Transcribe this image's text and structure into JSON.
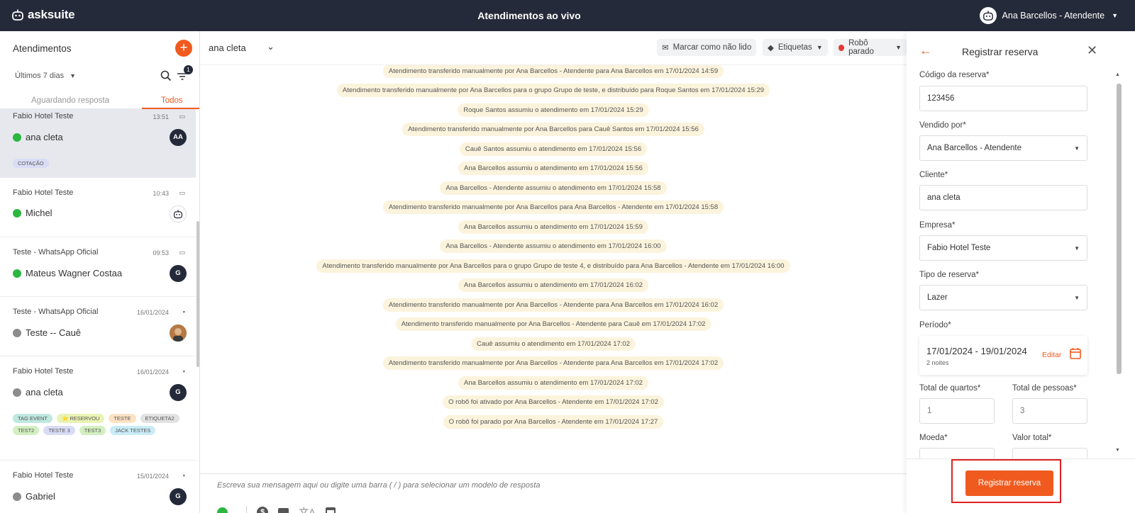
{
  "topbar": {
    "brand": "asksuite",
    "title": "Atendimentos ao vivo",
    "user": "Ana Barcellos - Atendente"
  },
  "left": {
    "title": "Atendimentos",
    "period": "Últimos 7 dias",
    "filter_count": "1",
    "tabs": [
      "Aguardando resposta",
      "Todos"
    ],
    "conversations": [
      {
        "source": "Fabio Hotel Teste",
        "time": "13:51",
        "name": "ana cleta",
        "avatar": "AA",
        "tags": [
          "COTAÇÃO"
        ]
      },
      {
        "source": "Fabio Hotel Teste",
        "time": "10:43",
        "name": "Michel",
        "avatar": "",
        "tags": []
      },
      {
        "source": "Teste - WhatsApp Oficial",
        "time": "09:53",
        "name": "Mateus Wagner Costaa",
        "avatar": "G",
        "tags": []
      },
      {
        "source": "Teste - WhatsApp Oficial",
        "time": "16/01/2024",
        "name": "Teste -- Cauê",
        "avatar": "",
        "tags": []
      },
      {
        "source": "Fabio Hotel Teste",
        "time": "16/01/2024",
        "name": "ana cleta",
        "avatar": "G",
        "tags": [
          "TAG EVENT",
          "⭐ RESERVOU",
          "TESTE",
          "ETIQUETA2",
          "TEST2",
          "TESTE 3",
          "TEST3",
          "JACK TESTES"
        ]
      },
      {
        "source": "Fabio Hotel Teste",
        "time": "15/01/2024",
        "name": "Gabriel",
        "avatar": "G",
        "tags": []
      }
    ]
  },
  "middle": {
    "contact_name": "ana cleta",
    "mark_unread": "Marcar como não lido",
    "labels": "Etiquetas",
    "robot_status": "Robô parado",
    "events": [
      "Atendimento transferido manualmente por Ana Barcellos - Atendente para Ana Barcellos em 17/01/2024 14:59",
      "Atendimento transferido manualmente por Ana Barcellos para o grupo Grupo de teste, e distribuído para Roque Santos em 17/01/2024 15:29",
      "Roque Santos assumiu o atendimento em 17/01/2024 15:29",
      "Atendimento transferido manualmente por Ana Barcellos para Cauê Santos em 17/01/2024 15:56",
      "Cauê Santos assumiu o atendimento em 17/01/2024 15:56",
      "Ana Barcellos assumiu o atendimento em 17/01/2024 15:56",
      "Ana Barcellos - Atendente assumiu o atendimento em 17/01/2024 15:58",
      "Atendimento transferido manualmente por Ana Barcellos para Ana Barcellos - Atendente em 17/01/2024 15:58",
      "Ana Barcellos assumiu o atendimento em 17/01/2024 15:59",
      "Ana Barcellos - Atendente assumiu o atendimento em 17/01/2024 16:00",
      "Atendimento transferido manualmente por Ana Barcellos para o grupo Grupo de teste 4, e distribuído para Ana Barcellos - Atendente em 17/01/2024 16:00",
      "Ana Barcellos assumiu o atendimento em 17/01/2024 16:02",
      "Atendimento transferido manualmente por Ana Barcellos - Atendente para Ana Barcellos em 17/01/2024 16:02",
      "Atendimento transferido manualmente por Ana Barcellos - Atendente para Cauê em 17/01/2024 17:02",
      "Cauê assumiu o atendimento em 17/01/2024 17:02",
      "Atendimento transferido manualmente por Ana Barcellos - Atendente para Ana Barcellos em 17/01/2024 17:02",
      "Ana Barcellos assumiu o atendimento em 17/01/2024 17:02",
      "O robô foi ativado por Ana Barcellos - Atendente em 17/01/2024 17:02",
      "O robô foi parado por Ana Barcellos - Atendente em 17/01/2024 17:27"
    ],
    "composer_placeholder": "Escreva sua mensagem aqui ou digite uma barra ( / ) para selecionar um modelo de resposta"
  },
  "right": {
    "title": "Registrar reserva",
    "fields": {
      "codigo_label": "Código da reserva*",
      "codigo_value": "123456",
      "vendido_label": "Vendido por*",
      "vendido_value": "Ana Barcellos - Atendente",
      "cliente_label": "Cliente*",
      "cliente_value": "ana cleta",
      "empresa_label": "Empresa*",
      "empresa_value": "Fabio Hotel Teste",
      "tipo_label": "Tipo de reserva*",
      "tipo_value": "Lazer",
      "periodo_label": "Período*",
      "periodo_dates": "17/01/2024 - 19/01/2024",
      "periodo_nights": "2 noites",
      "periodo_edit": "Editar",
      "quartos_label": "Total de quartos*",
      "quartos_value": "1",
      "pessoas_label": "Total de pessoas*",
      "pessoas_value": "3",
      "moeda_label": "Moeda*",
      "valor_label": "Valor total*"
    },
    "submit": "Registrar reserva"
  },
  "colors": {
    "accent": "#f05a1f",
    "topbar": "#252a3a",
    "event_bg": "#fbf3dc",
    "highlight": "#e02020"
  }
}
